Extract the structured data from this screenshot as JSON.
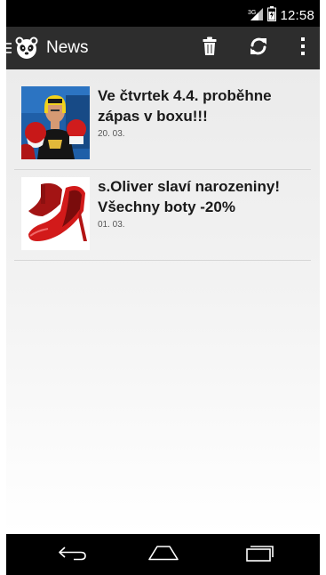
{
  "status_bar": {
    "time": "12:58",
    "network_label": "3G",
    "icons": [
      "signal-icon",
      "battery-icon"
    ]
  },
  "action_bar": {
    "title": "News",
    "logo_icon": "panda-logo-icon",
    "menu_icon": "drawer-menu-icon",
    "actions": [
      {
        "name": "delete",
        "icon": "trash-icon"
      },
      {
        "name": "refresh",
        "icon": "refresh-icon"
      },
      {
        "name": "more",
        "icon": "overflow-menu-icon"
      }
    ]
  },
  "news": {
    "items": [
      {
        "title": "Ve čtvrtek 4.4. proběhne zápas v boxu!!!",
        "date": "20. 03.",
        "image_icon": "boxer-photo"
      },
      {
        "title": "s.Oliver slaví narozeniny! Všechny boty -20%",
        "date": "01. 03.",
        "image_icon": "red-shoe-photo"
      }
    ]
  },
  "nav_bar": {
    "buttons": [
      "back-icon",
      "home-icon",
      "recents-icon"
    ]
  },
  "colors": {
    "action_bar": "#2d2d2d",
    "status_bar": "#000000",
    "title_text": "#1a1a1a",
    "accent_red": "#d21a1a"
  }
}
